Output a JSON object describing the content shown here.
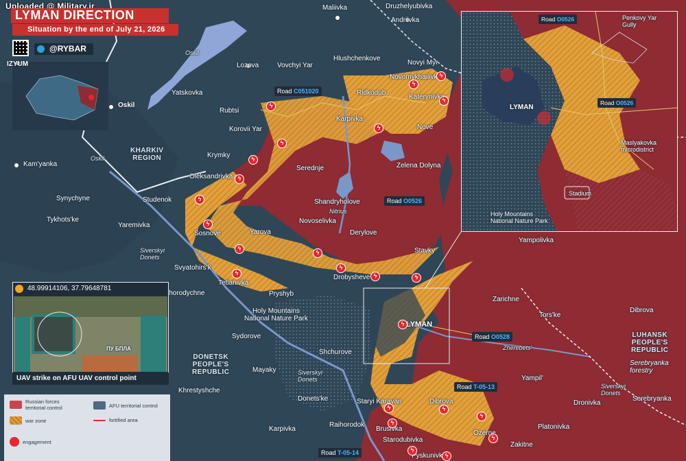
{
  "watermark": "Uploaded @ Military.ir",
  "header": {
    "title": "LYMAN DIRECTION",
    "subtitle": "Situation by the end of July 21, 2026",
    "brand": "@RYBAR"
  },
  "colors": {
    "russian_forces": "#8e2b33",
    "afu_territory": "#2f4657",
    "war_zone": "#e8a63a",
    "engagement": "#e8262b",
    "road_number": "#4fb3ff",
    "water": "#8fa6d6"
  },
  "regions": {
    "kharkiv": "KHARKIV\nREGION",
    "donetsk": "DONETSK\nPEOPLE'S\nREPUBLIC",
    "luhansk": "LUHANSK\nPEOPLE'S\nREPUBLIC"
  },
  "settlements": [
    {
      "name": "Maliivka"
    },
    {
      "name": "Druzhelyubivka"
    },
    {
      "name": "Andriivka"
    },
    {
      "name": "IZYUM"
    },
    {
      "name": "Hlushchenkove"
    },
    {
      "name": "Novyi Myr"
    },
    {
      "name": "Lozova"
    },
    {
      "name": "Vovchyi Yar"
    },
    {
      "name": "Novomykhailivka"
    },
    {
      "name": "Oskil"
    },
    {
      "name": "Yatskovka"
    },
    {
      "name": "Ridkodub"
    },
    {
      "name": "Katerynivka"
    },
    {
      "name": "Rubtsi"
    },
    {
      "name": "Karpivka"
    },
    {
      "name": "Nove"
    },
    {
      "name": "Korovii Yar"
    },
    {
      "name": "Kam'yanka"
    },
    {
      "name": "Krymky"
    },
    {
      "name": "Serednje"
    },
    {
      "name": "Zelena Dolyna"
    },
    {
      "name": "Oleksandrivka"
    },
    {
      "name": "Synychyne"
    },
    {
      "name": "Studenok"
    },
    {
      "name": "Shandryholove"
    },
    {
      "name": "Tykhots'ke"
    },
    {
      "name": "Yaremivka"
    },
    {
      "name": "Novoselivka"
    },
    {
      "name": "Sosnove"
    },
    {
      "name": "Yarova"
    },
    {
      "name": "Derylove"
    },
    {
      "name": "Yampolivka"
    },
    {
      "name": "Stavky"
    },
    {
      "name": "Svyatohirs'k"
    },
    {
      "name": "Drobysheve"
    },
    {
      "name": "Tetianivka"
    },
    {
      "name": "Bohorodychne"
    },
    {
      "name": "Pryshyb"
    },
    {
      "name": "Zarichne"
    },
    {
      "name": "LYMAN"
    },
    {
      "name": "Tors'ke"
    },
    {
      "name": "Dibrova"
    },
    {
      "name": "Sydorove"
    },
    {
      "name": "Shchurove"
    },
    {
      "name": "Mayaky"
    },
    {
      "name": "Yampil'"
    },
    {
      "name": "Khrestyshche"
    },
    {
      "name": "Donets'ke"
    },
    {
      "name": "Staryi Karavan"
    },
    {
      "name": "Dibrova"
    },
    {
      "name": "Dronivka"
    },
    {
      "name": "Serebryanka"
    },
    {
      "name": "Raihorodok"
    },
    {
      "name": "Brusivka"
    },
    {
      "name": "Platonivka"
    },
    {
      "name": "Karpivka"
    },
    {
      "name": "Starodubivka"
    },
    {
      "name": "Ozerne"
    },
    {
      "name": "Zakitne"
    },
    {
      "name": "Pyskunivka"
    }
  ],
  "rivers": {
    "oskil_1": "Oskil",
    "oskil_2": "Oskil",
    "nitrius": "Nitrius",
    "siverskyi_donets_1": "Siverskyi\nDonets",
    "siverskyi_donets_2": "Siverskyi\nDonets",
    "siverskyi_donets_3": "Siverskyi\nDonets",
    "zherebets": "Zherebets'"
  },
  "features": {
    "holy_mountains": "Holy Mountains\nNational Nature Park",
    "serebryanka_forestry": "Serebryanka\nforestry"
  },
  "roads": [
    {
      "prefix": "Road",
      "number": "C051020"
    },
    {
      "prefix": "Road",
      "number": "O0526"
    },
    {
      "prefix": "Road",
      "number": "O0528"
    },
    {
      "prefix": "Road",
      "number": "T-05-13"
    },
    {
      "prefix": "Road",
      "number": "T-05-14"
    }
  ],
  "inset": {
    "city": "LYMAN",
    "road_top": {
      "prefix": "Road",
      "number": "O0526"
    },
    "road_right": {
      "prefix": "Road",
      "number": "O0526"
    },
    "penkovy": "Penkovy Yar\nGully",
    "maslyakovka": "Maslyakovka\nmicrodistrict",
    "stadium": "Stadium",
    "park": "Holy Mountains\nNational Nature Park"
  },
  "video": {
    "coords": "48.99914106, 37.79648781",
    "overlay_text": "ПУ БПЛА",
    "caption": "UAV strike on AFU UAV control point"
  },
  "legend": {
    "russian_forces": "Russian forces\nterritorial control",
    "afu": "AFU territorial control",
    "war_zone": "war zone",
    "fortified": "fortified area",
    "engagement": "engagement"
  }
}
